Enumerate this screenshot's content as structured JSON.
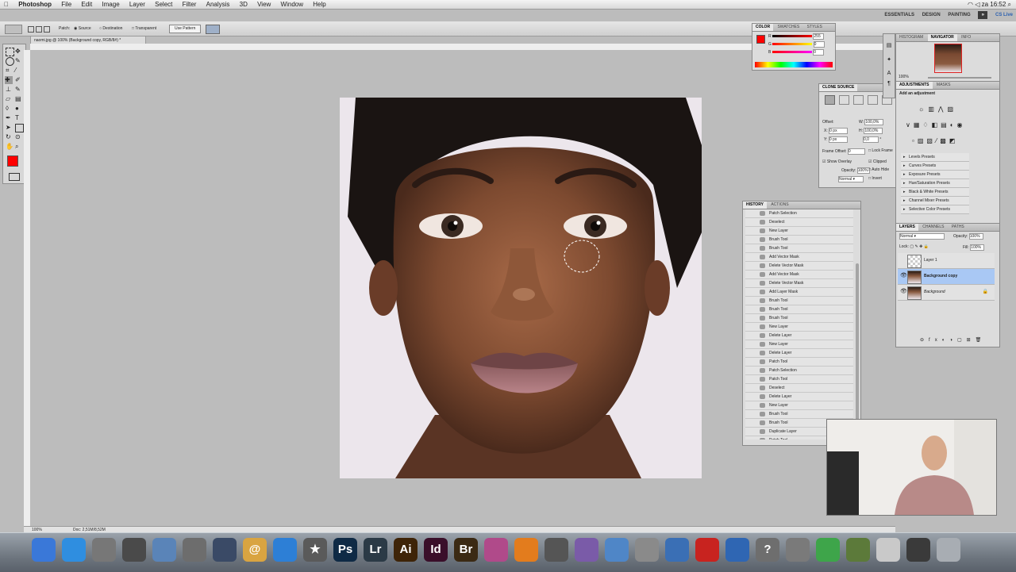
{
  "menubar": {
    "app_name": "Photoshop",
    "items": [
      "File",
      "Edit",
      "Image",
      "Layer",
      "Select",
      "Filter",
      "Analysis",
      "3D",
      "View",
      "Window",
      "Help"
    ],
    "clock": "za 16:52"
  },
  "workspace": {
    "buttons": [
      "ESSENTIALS",
      "DESIGN",
      "PAINTING"
    ],
    "cs_live": "CS Live"
  },
  "options": {
    "patch_label": "Patch:",
    "source_label": "Source",
    "destination_label": "Destination",
    "transparent_label": "Transparent",
    "use_pattern_label": "Use Pattern",
    "zoom_value": "100%"
  },
  "document": {
    "tab_title": "naomi.jpg @ 100% (Background copy, RGB/8#) *",
    "zoom_status": "100%",
    "doc_status": "Doc: 2,51M/8,52M"
  },
  "color_panel": {
    "tabs": [
      "COLOR",
      "SWATCHES",
      "STYLES"
    ],
    "r_value": "255",
    "g_value": "0",
    "b_value": "0",
    "fg_color": "#ff0000"
  },
  "clone_source": {
    "title": "CLONE SOURCE",
    "offset_label": "Offset:",
    "x_value": "0 px",
    "y_value": "0 px",
    "w_value": "100,0%",
    "h_value": "100,0%",
    "angle_value": "0,0",
    "frame_offset_label": "Frame Offset:",
    "frame_offset_value": "0",
    "lock_frame_label": "Lock Frame",
    "show_overlay_label": "Show Overlay",
    "clipped_label": "Clipped",
    "opacity_label": "Opacity:",
    "opacity_value": "100%",
    "auto_hide_label": "Auto Hide",
    "blend_mode": "Normal",
    "invert_label": "Invert"
  },
  "history": {
    "tabs": [
      "HISTORY",
      "ACTIONS"
    ],
    "items": [
      "Patch Selection",
      "Deselect",
      "New Layer",
      "Brush Tool",
      "Brush Tool",
      "Add Vector Mask",
      "Delete Vector Mask",
      "Add Vector Mask",
      "Delete Vector Mask",
      "Add Layer Mask",
      "Brush Tool",
      "Brush Tool",
      "Brush Tool",
      "New Layer",
      "Delete Layer",
      "New Layer",
      "Delete Layer",
      "Patch Tool",
      "Patch Selection",
      "Patch Tool",
      "Deselect",
      "Delete Layer",
      "New Layer",
      "Brush Tool",
      "Brush Tool",
      "Duplicate Layer",
      "Patch Tool",
      "Patch Selection",
      "Patch Tool"
    ],
    "selected_index": 28
  },
  "navigator": {
    "tabs": [
      "HISTOGRAM",
      "NAVIGATOR",
      "INFO"
    ],
    "zoom": "100%"
  },
  "adjustments": {
    "tabs": [
      "ADJUSTMENTS",
      "MASKS"
    ],
    "heading": "Add an adjustment",
    "presets": [
      "Levels Presets",
      "Curves Presets",
      "Exposure Presets",
      "Hue/Saturation Presets",
      "Black & White Presets",
      "Channel Mixer Presets",
      "Selective Color Presets"
    ]
  },
  "layers": {
    "tabs": [
      "LAYERS",
      "CHANNELS",
      "PATHS"
    ],
    "blend_mode": "Normal",
    "opacity_label": "Opacity:",
    "opacity_value": "100%",
    "lock_label": "Lock:",
    "fill_label": "Fill:",
    "fill_value": "100%",
    "rows": [
      {
        "name": "Layer 1",
        "visible": false,
        "selected": false
      },
      {
        "name": "Background copy",
        "visible": true,
        "selected": true
      },
      {
        "name": "Background",
        "visible": true,
        "selected": false
      }
    ]
  },
  "dock": {
    "icons": [
      {
        "name": "finder-icon",
        "label": "",
        "color": "#3a78d8"
      },
      {
        "name": "safari-icon",
        "label": "",
        "color": "#2f8ee0"
      },
      {
        "name": "launchpad-icon",
        "label": "",
        "color": "#777777"
      },
      {
        "name": "activity-icon",
        "label": "",
        "color": "#4a4a4a"
      },
      {
        "name": "preview-icon",
        "label": "",
        "color": "#5a84b8"
      },
      {
        "name": "system-preferences-icon",
        "label": "",
        "color": "#6d6d6d"
      },
      {
        "name": "quicktime-icon",
        "label": "",
        "color": "#3a4a66"
      },
      {
        "name": "address-book-icon",
        "label": "@",
        "color": "#d9a441"
      },
      {
        "name": "itunes-icon",
        "label": "",
        "color": "#2d7fd6"
      },
      {
        "name": "imovie-icon",
        "label": "★",
        "color": "#5a5a5a"
      },
      {
        "name": "photoshop-icon",
        "label": "Ps",
        "color": "#0f2a45"
      },
      {
        "name": "lightroom-icon",
        "label": "Lr",
        "color": "#2b3a46"
      },
      {
        "name": "illustrator-icon",
        "label": "Ai",
        "color": "#3e2408"
      },
      {
        "name": "indesign-icon",
        "label": "Id",
        "color": "#3a0f2a"
      },
      {
        "name": "bridge-icon",
        "label": "Br",
        "color": "#3b2a14"
      },
      {
        "name": "aperture-icon",
        "label": "",
        "color": "#b04a8a"
      },
      {
        "name": "vlc-icon",
        "label": "",
        "color": "#e37c1d"
      },
      {
        "name": "printer-icon",
        "label": "",
        "color": "#555555"
      },
      {
        "name": "creative-cloud-icon",
        "label": "",
        "color": "#7a5ba8"
      },
      {
        "name": "document-icon",
        "label": "",
        "color": "#4f86c7"
      },
      {
        "name": "scanner-icon",
        "label": "",
        "color": "#8a8a8a"
      },
      {
        "name": "network-icon",
        "label": "",
        "color": "#3a6fb5"
      },
      {
        "name": "acrobat-icon",
        "label": "",
        "color": "#c8231f"
      },
      {
        "name": "sync-icon",
        "label": "",
        "color": "#2f66b3"
      },
      {
        "name": "help-icon",
        "label": "?",
        "color": "#6e6e6e"
      },
      {
        "name": "camera-icon",
        "label": "",
        "color": "#7a7a7a"
      },
      {
        "name": "download-icon",
        "label": "",
        "color": "#3ea54a"
      },
      {
        "name": "script-icon",
        "label": "",
        "color": "#5c7a3a"
      },
      {
        "name": "stack-icon",
        "label": "",
        "color": "#c9c9c9"
      },
      {
        "name": "screen-icon",
        "label": "",
        "color": "#3a3a3a"
      },
      {
        "name": "trash-icon",
        "label": "",
        "color": "#a8adb3"
      }
    ]
  }
}
